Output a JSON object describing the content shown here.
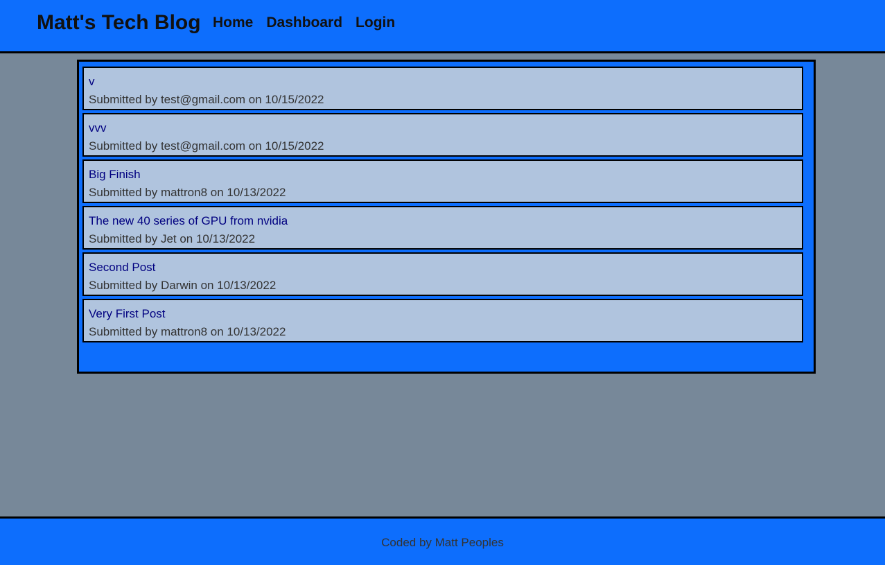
{
  "header": {
    "title": "Matt's Tech Blog",
    "nav": [
      {
        "label": "Home"
      },
      {
        "label": "Dashboard"
      },
      {
        "label": "Login"
      }
    ]
  },
  "posts": [
    {
      "title": "v",
      "meta": "Submitted by test@gmail.com on 10/15/2022"
    },
    {
      "title": "vvv",
      "meta": "Submitted by test@gmail.com on 10/15/2022"
    },
    {
      "title": "Big Finish",
      "meta": "Submitted by mattron8 on 10/13/2022"
    },
    {
      "title": "The new 40 series of GPU from nvidia",
      "meta": "Submitted by Jet on 10/13/2022"
    },
    {
      "title": "Second Post",
      "meta": "Submitted by Darwin on 10/13/2022"
    },
    {
      "title": "Very First Post",
      "meta": "Submitted by mattron8 on 10/13/2022"
    }
  ],
  "footer": {
    "text": "Coded by Matt Peoples"
  },
  "colors": {
    "header_bg": "#0d6efd",
    "page_bg": "#778899",
    "card_bg": "#b0c4de",
    "link": "#000080"
  }
}
